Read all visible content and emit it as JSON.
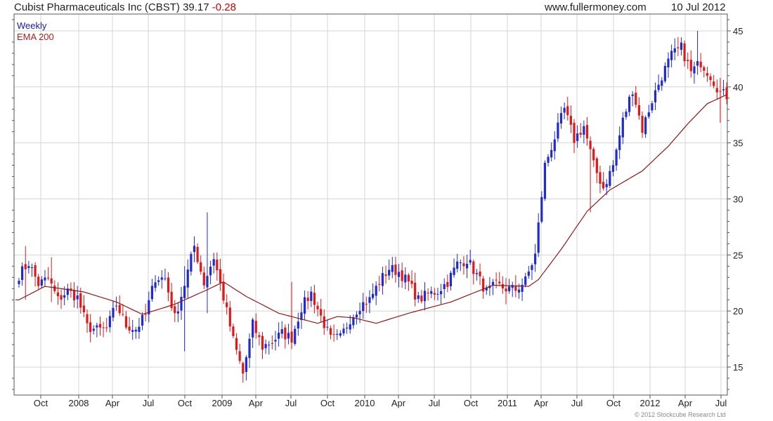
{
  "header": {
    "title": "Cubist Pharmaceuticals Inc (CBST) 39.17",
    "change": "-0.28",
    "site": "www.fullermoney.com",
    "date": "10 Jul 2012"
  },
  "legend": {
    "period": "Weekly",
    "indicator": "EMA 200"
  },
  "copyright": "© 2012 Stockcube Research Ltd",
  "colors": {
    "up": "#1f2bd0",
    "down": "#e01818",
    "ema": "#8b1a1a",
    "grid": "#d4d4d4",
    "axis": "#555555"
  },
  "chart_data": {
    "type": "candlestick",
    "title": "Cubist Pharmaceuticals Inc (CBST) 39.17 -0.28",
    "period": "Weekly",
    "ylim": [
      12.5,
      46.5
    ],
    "yticks": [
      15,
      20,
      25,
      30,
      35,
      40,
      45
    ],
    "x_labels": [
      "Oct",
      "2008",
      "Apr",
      "Jul",
      "Oct",
      "2009",
      "Apr",
      "Jul",
      "Oct",
      "2010",
      "Apr",
      "Jul",
      "Oct",
      "2011",
      "Apr",
      "Jul",
      "Oct",
      "2012",
      "Apr",
      "Jul"
    ],
    "grid": true,
    "legend": [
      "Weekly",
      "EMA 200"
    ],
    "price_anchors": [
      [
        0,
        23.2
      ],
      [
        3,
        24.3
      ],
      [
        6,
        22.4
      ],
      [
        9,
        22.9
      ],
      [
        12,
        21.0
      ],
      [
        15,
        21.8
      ],
      [
        18,
        21.2
      ],
      [
        21,
        18.6
      ],
      [
        24,
        18.3
      ],
      [
        27,
        18.4
      ],
      [
        30,
        20.6
      ],
      [
        33,
        18.7
      ],
      [
        36,
        18.4
      ],
      [
        39,
        19.6
      ],
      [
        42,
        23.0
      ],
      [
        45,
        22.9
      ],
      [
        48,
        19.4
      ],
      [
        51,
        22.4
      ],
      [
        54,
        25.8
      ],
      [
        57,
        22.5
      ],
      [
        60,
        24.8
      ],
      [
        63,
        21.2
      ],
      [
        66,
        17.4
      ],
      [
        69,
        14.4
      ],
      [
        72,
        18.8
      ],
      [
        75,
        16.8
      ],
      [
        78,
        17.3
      ],
      [
        81,
        18.0
      ],
      [
        84,
        17.6
      ],
      [
        87,
        20.3
      ],
      [
        90,
        21.6
      ],
      [
        93,
        19.5
      ],
      [
        96,
        17.5
      ],
      [
        99,
        17.6
      ],
      [
        102,
        19.3
      ],
      [
        105,
        20.5
      ],
      [
        108,
        21.0
      ],
      [
        111,
        22.6
      ],
      [
        114,
        23.8
      ],
      [
        117,
        23.5
      ],
      [
        120,
        22.5
      ],
      [
        123,
        21.0
      ],
      [
        126,
        21.5
      ],
      [
        129,
        21.8
      ],
      [
        132,
        22.6
      ],
      [
        135,
        24.2
      ],
      [
        138,
        24.6
      ],
      [
        141,
        23.2
      ],
      [
        144,
        21.7
      ],
      [
        147,
        22.3
      ],
      [
        150,
        22.0
      ],
      [
        153,
        21.9
      ],
      [
        156,
        22.7
      ],
      [
        159,
        25.0
      ],
      [
        162,
        33.0
      ],
      [
        165,
        35.5
      ],
      [
        168,
        38.0
      ],
      [
        171,
        35.3
      ],
      [
        174,
        36.5
      ],
      [
        177,
        33.0
      ],
      [
        180,
        31.0
      ],
      [
        183,
        33.0
      ],
      [
        186,
        37.0
      ],
      [
        189,
        39.8
      ],
      [
        192,
        36.2
      ],
      [
        195,
        38.8
      ],
      [
        198,
        41.0
      ],
      [
        201,
        42.8
      ],
      [
        204,
        43.5
      ],
      [
        207,
        41.3
      ],
      [
        210,
        42.2
      ],
      [
        213,
        41.0
      ],
      [
        216,
        39.5
      ],
      [
        218,
        39.2
      ]
    ],
    "ema_anchors": [
      [
        0,
        21.0
      ],
      [
        8,
        22.2
      ],
      [
        20,
        21.7
      ],
      [
        30,
        20.8
      ],
      [
        38,
        19.7
      ],
      [
        48,
        20.6
      ],
      [
        58,
        21.9
      ],
      [
        63,
        22.6
      ],
      [
        70,
        21.3
      ],
      [
        80,
        19.8
      ],
      [
        92,
        18.9
      ],
      [
        98,
        19.5
      ],
      [
        103,
        19.4
      ],
      [
        110,
        18.9
      ],
      [
        120,
        19.8
      ],
      [
        133,
        20.8
      ],
      [
        146,
        22.3
      ],
      [
        157,
        22.2
      ],
      [
        160,
        22.8
      ],
      [
        167,
        25.5
      ],
      [
        175,
        28.9
      ],
      [
        182,
        30.8
      ],
      [
        192,
        32.5
      ],
      [
        200,
        34.7
      ],
      [
        206,
        36.7
      ],
      [
        212,
        38.5
      ],
      [
        218,
        39.3
      ]
    ],
    "spikes": [
      [
        2,
        25.8,
        21.0
      ],
      [
        10,
        24.8,
        20.8
      ],
      [
        51,
        24.0,
        16.4
      ],
      [
        58,
        28.8,
        19.8
      ],
      [
        69,
        14.9,
        13.8
      ],
      [
        84,
        22.6,
        16.6
      ],
      [
        150,
        22.5,
        20.6
      ],
      [
        176,
        32.8,
        28.8
      ],
      [
        209,
        45.0,
        42.0
      ],
      [
        216,
        40.8,
        36.8
      ]
    ],
    "source_series_length": 219
  }
}
